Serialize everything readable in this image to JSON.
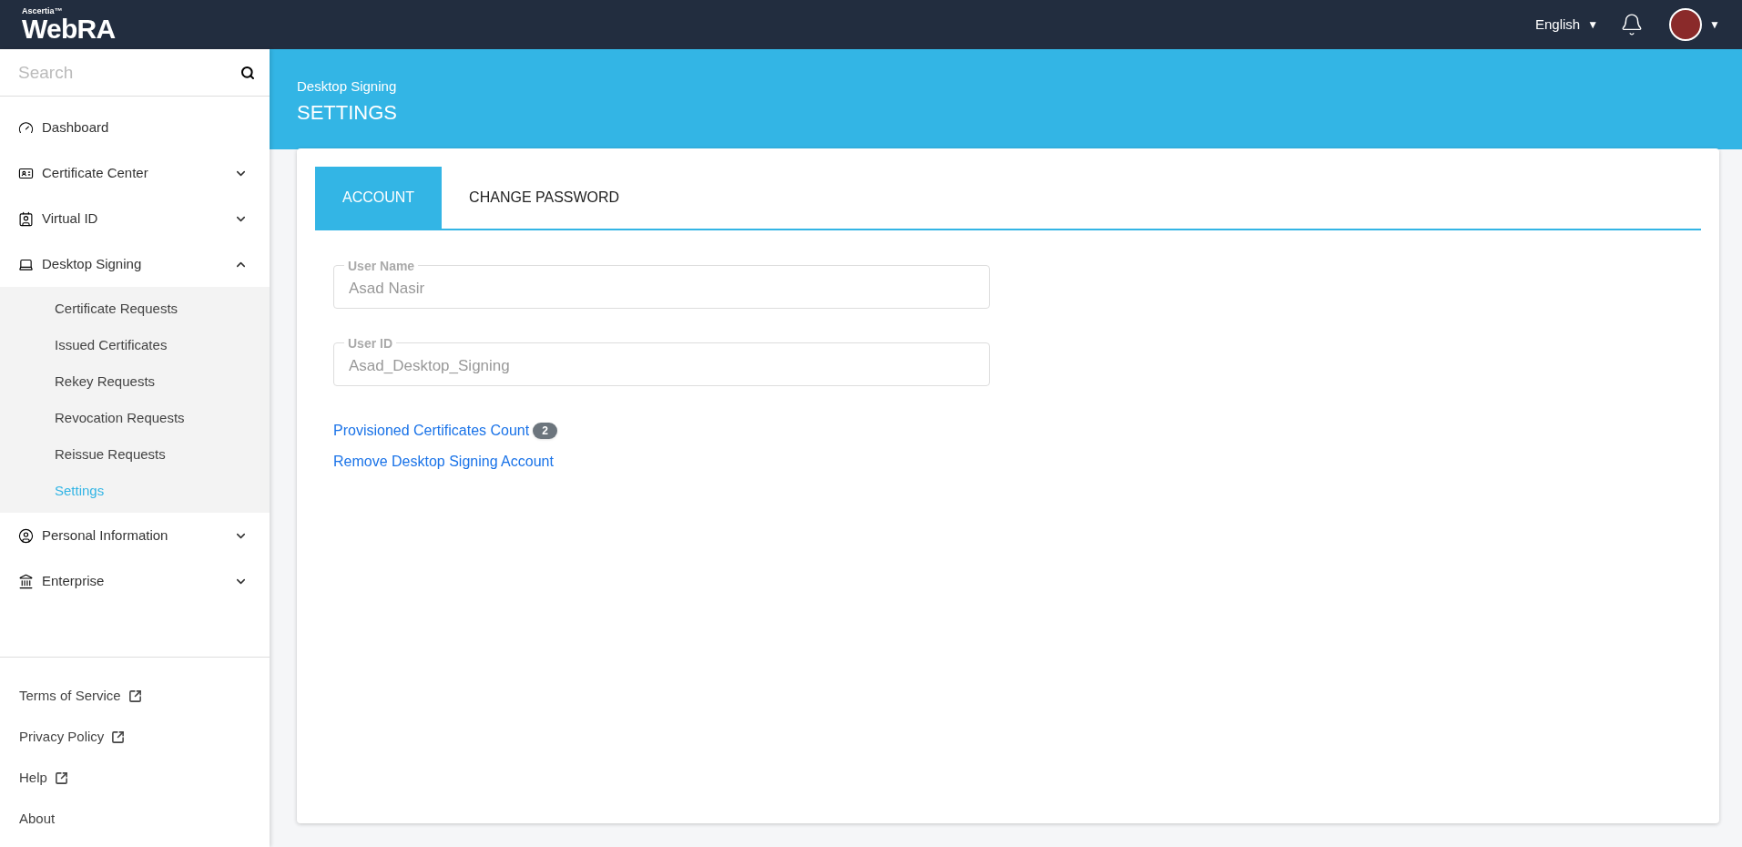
{
  "header": {
    "logo_small": "Ascertia™",
    "logo": "WebRA",
    "language": "English",
    "language_caret": "▼",
    "avatar_caret": "▼"
  },
  "sidebar": {
    "search": {
      "placeholder": "Search"
    },
    "items": [
      {
        "label": "Dashboard",
        "kind": "link"
      },
      {
        "label": "Certificate Center",
        "kind": "group",
        "expanded": false
      },
      {
        "label": "Virtual ID",
        "kind": "group",
        "expanded": false
      },
      {
        "label": "Desktop Signing",
        "kind": "group",
        "expanded": true,
        "children": [
          {
            "label": "Certificate Requests",
            "selected": false
          },
          {
            "label": "Issued Certificates",
            "selected": false
          },
          {
            "label": "Rekey Requests",
            "selected": false
          },
          {
            "label": "Revocation Requests",
            "selected": false
          },
          {
            "label": "Reissue Requests",
            "selected": false
          },
          {
            "label": "Settings",
            "selected": true
          }
        ]
      },
      {
        "label": "Personal Information",
        "kind": "group",
        "expanded": false
      },
      {
        "label": "Enterprise",
        "kind": "group",
        "expanded": false
      }
    ],
    "footer": [
      {
        "label": "Terms of Service",
        "external": true
      },
      {
        "label": "Privacy Policy",
        "external": true
      },
      {
        "label": "Help",
        "external": true
      },
      {
        "label": "About",
        "external": false
      }
    ]
  },
  "page": {
    "subtitle": "Desktop Signing",
    "title": "SETTINGS"
  },
  "tabs": [
    {
      "label": "ACCOUNT",
      "selected": true
    },
    {
      "label": "CHANGE PASSWORD",
      "selected": false
    }
  ],
  "fields": [
    {
      "label": "User Name",
      "value": "Asad Nasir"
    },
    {
      "label": "User ID",
      "value": "Asad_Desktop_Signing"
    }
  ],
  "links": [
    {
      "label": "Provisioned Certificates Count",
      "badge": "2"
    },
    {
      "label": "Remove Desktop Signing Account"
    }
  ]
}
